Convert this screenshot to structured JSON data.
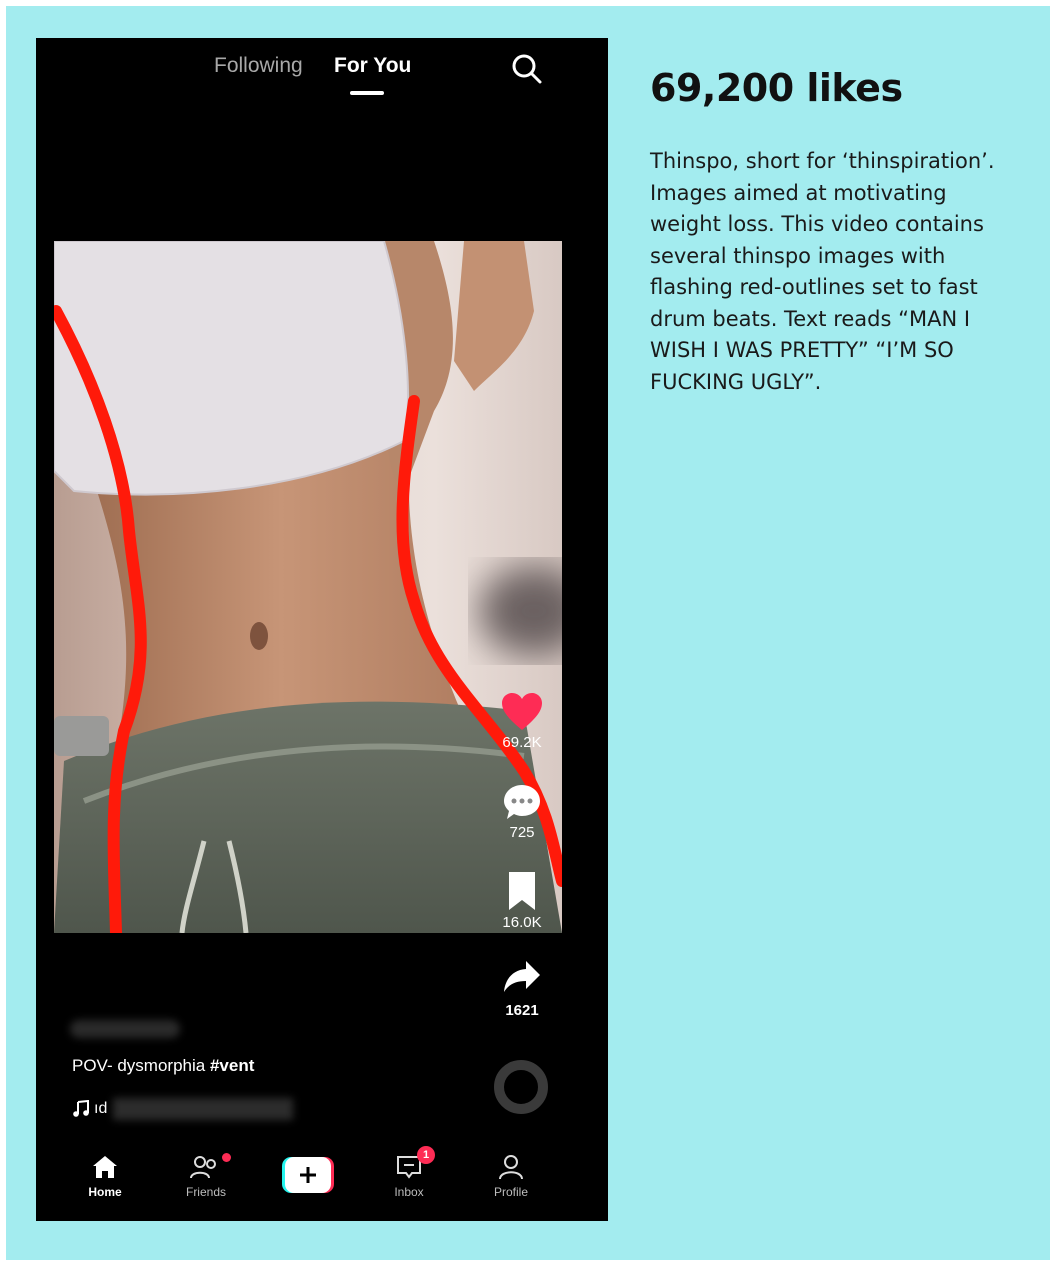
{
  "app": {
    "top_tabs": [
      "Following",
      "For You"
    ],
    "active_tab": "For You"
  },
  "video": {
    "caption_prefix": "POV- dysmorphia ",
    "caption_hashtag": "#vent",
    "music_prefix": "ıd"
  },
  "actions": {
    "likes": "69.2K",
    "comments": "725",
    "saves": "16.0K",
    "shares": "1621"
  },
  "bottom_nav": {
    "home": "Home",
    "friends": "Friends",
    "inbox": "Inbox",
    "inbox_badge": "1",
    "profile": "Profile"
  },
  "colors": {
    "panel_background": "#a3ecef",
    "like_red": "#fe2c55",
    "outline_red": "#ff1a0a"
  },
  "annotation": {
    "title": "69,200 likes",
    "description": "Thinspo, short for ‘thinspiration’. Images aimed at motivating weight loss. This video contains several thinspo images with flashing red-outlines set to fast drum beats. Text reads “MAN I WISH I WAS PRETTY” “I’M SO FUCKING UGLY”."
  }
}
